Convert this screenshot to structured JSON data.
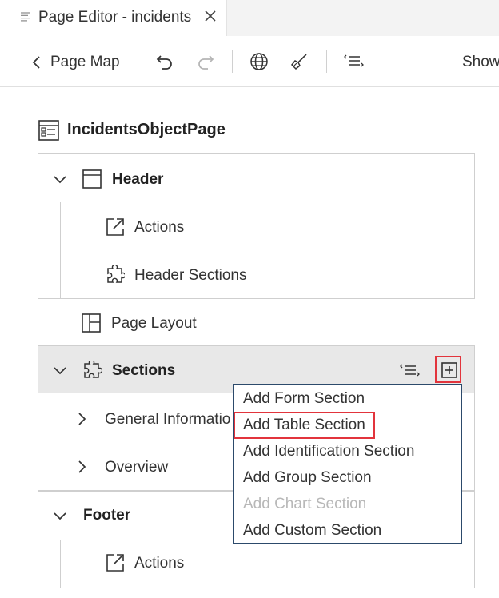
{
  "tab": {
    "title": "Page Editor - incidents"
  },
  "toolbar": {
    "back_label": "Page Map",
    "show_label": "Show"
  },
  "page": {
    "title": "IncidentsObjectPage"
  },
  "tree": {
    "header": {
      "label": "Header",
      "actions": "Actions",
      "header_sections": "Header Sections"
    },
    "page_layout": "Page Layout",
    "sections": {
      "label": "Sections",
      "general": "General Informatio",
      "overview": "Overview"
    },
    "footer": {
      "label": "Footer",
      "actions": "Actions"
    }
  },
  "menu": {
    "items": [
      {
        "label": "Add Form Section",
        "enabled": true
      },
      {
        "label": "Add Table Section",
        "enabled": true
      },
      {
        "label": "Add Identification Section",
        "enabled": true
      },
      {
        "label": "Add Group Section",
        "enabled": true
      },
      {
        "label": "Add Chart Section",
        "enabled": false
      },
      {
        "label": "Add Custom Section",
        "enabled": true
      }
    ]
  },
  "colors": {
    "highlight": "#e2343c",
    "sections_bg": "#e8e8e8",
    "disabled_text": "#b8b8b8"
  }
}
